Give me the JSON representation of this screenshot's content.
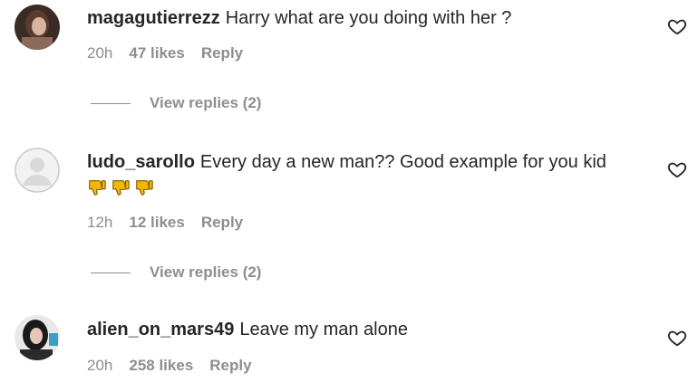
{
  "comments": [
    {
      "username": "magagutierrezz",
      "text": "Harry what are you doing with her ?",
      "time": "20h",
      "likes": "47 likes",
      "reply_label": "Reply",
      "view_replies": "View replies (2)",
      "avatar_icon": "user-photo-avatar",
      "like_icon": "heart-outline-icon"
    },
    {
      "username": "ludo_sarollo",
      "text": "Every day a new man?? Good example for you kid",
      "emoji": "👎👎👎",
      "time": "12h",
      "likes": "12 likes",
      "reply_label": "Reply",
      "view_replies": "View replies (2)",
      "avatar_icon": "default-avatar-icon",
      "like_icon": "heart-outline-icon"
    },
    {
      "username": "alien_on_mars49",
      "text": "Leave my man alone",
      "time": "20h",
      "likes": "258 likes",
      "reply_label": "Reply",
      "avatar_icon": "user-photo-avatar",
      "like_icon": "heart-outline-icon"
    }
  ],
  "colors": {
    "text": "#262626",
    "secondary": "#8e8e8e",
    "thumb_emoji": "#f2b705"
  }
}
